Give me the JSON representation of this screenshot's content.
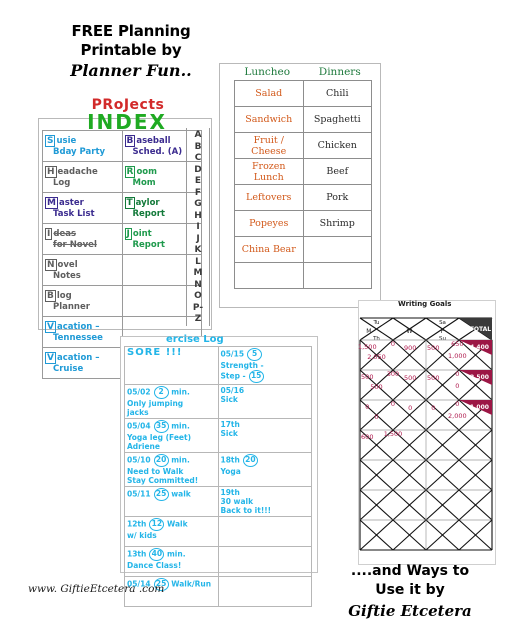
{
  "header": {
    "line1": "FREE Planning",
    "line2": "Printable by",
    "brand": "Planner Fun.."
  },
  "projects": {
    "kicker": "PRoJects",
    "title": "INDEX",
    "rows": [
      {
        "left": {
          "initial": "S",
          "l1": "usie",
          "l2": "Bday Party",
          "color": "c-blue",
          "strike": false,
          "suffix": ""
        },
        "right": {
          "initial": "B",
          "l1": "aseball",
          "l2": "Sched.",
          "color": "c-purple",
          "strike": false,
          "suffix": "A"
        }
      },
      {
        "left": {
          "initial": "H",
          "l1": "eadache",
          "l2": "Log",
          "color": "c-gray",
          "strike": false,
          "suffix": ""
        },
        "right": {
          "initial": "R",
          "l1": "oom",
          "l2": "Mom",
          "color": "c-green",
          "strike": false,
          "suffix": ""
        }
      },
      {
        "left": {
          "initial": "M",
          "l1": "aster",
          "l2": "Task List",
          "color": "c-purple",
          "strike": false,
          "suffix": ""
        },
        "right": {
          "initial": "T",
          "l1": "aylor",
          "l2": "Report",
          "color": "c-dgreen",
          "strike": false,
          "suffix": ""
        }
      },
      {
        "left": {
          "initial": "I",
          "l1": "deas",
          "l2": "for Novel",
          "color": "c-gray",
          "strike": true,
          "suffix": ""
        },
        "right": {
          "initial": "J",
          "l1": "oint",
          "l2": "Report",
          "color": "c-green",
          "strike": false,
          "suffix": ""
        }
      },
      {
        "left": {
          "initial": "N",
          "l1": "ovel",
          "l2": "Notes",
          "color": "c-gray",
          "strike": false,
          "suffix": ""
        },
        "right": {
          "initial": "",
          "l1": "",
          "l2": "",
          "color": "c-gray",
          "strike": false,
          "suffix": ""
        }
      },
      {
        "left": {
          "initial": "B",
          "l1": "log",
          "l2": "Planner",
          "color": "c-gray",
          "strike": false,
          "suffix": ""
        },
        "right": {
          "initial": "",
          "l1": "",
          "l2": "",
          "color": "c-gray",
          "strike": false,
          "suffix": ""
        }
      },
      {
        "left": {
          "initial": "V",
          "l1": "acation –",
          "l2": "Tennessee",
          "color": "c-blue",
          "strike": false,
          "suffix": ""
        },
        "right": {
          "initial": "",
          "l1": "",
          "l2": "",
          "color": "c-gray",
          "strike": false,
          "suffix": ""
        }
      },
      {
        "left": {
          "initial": "V",
          "l1": "acation –",
          "l2": "Cruise",
          "color": "c-blue",
          "strike": false,
          "suffix": ""
        },
        "right": {
          "initial": "",
          "l1": "",
          "l2": "",
          "color": "c-gray",
          "strike": false,
          "suffix": ""
        }
      }
    ],
    "alphabet_tabs": [
      "A",
      "B",
      "C",
      "D",
      "E",
      "F",
      "G",
      "H",
      "I",
      "J",
      "K",
      "L",
      "M",
      "N",
      "O",
      "P-",
      "Z"
    ]
  },
  "meals": {
    "headers": [
      "Luncheo",
      "Dinners"
    ],
    "rows": [
      {
        "lunch": "Salad",
        "dinner": "Chili",
        "small": false
      },
      {
        "lunch": "Sandwich",
        "dinner": "Spaghetti",
        "small": false
      },
      {
        "lunch": "Fruit / Cheese",
        "dinner": "Chicken",
        "small": true
      },
      {
        "lunch": "Frozen Lunch",
        "dinner": "Beef",
        "small": true
      },
      {
        "lunch": "Leftovers",
        "dinner": "Pork",
        "small": false
      },
      {
        "lunch": "Popeyes",
        "dinner": "Shrimp",
        "small": false
      },
      {
        "lunch": "China Bear",
        "dinner": "",
        "small": false
      },
      {
        "lunch": "",
        "dinner": "",
        "small": false
      }
    ]
  },
  "exercise": {
    "title": "ercise Log",
    "banner": "SORE !!!",
    "rows": [
      {
        "left": {
          "date": "",
          "badge": "",
          "note1": "SORE !!!",
          "note2": "",
          "note3": "",
          "banner": true
        },
        "right": {
          "date": "05/15",
          "badge": "5",
          "note1": "Strength -",
          "note2": "Step -",
          "badge2": "15",
          "note3": ""
        }
      },
      {
        "left": {
          "date": "05/02",
          "badge": "2",
          "unit": "min.",
          "note1": "Only jumping",
          "note2": "jacks",
          "note3": ""
        },
        "right": {
          "date": "05/16",
          "badge": "",
          "note1": "Sick",
          "note2": "",
          "note3": ""
        }
      },
      {
        "left": {
          "date": "05/04",
          "badge": "35",
          "unit": "min.",
          "note1": "Yoga leg (Feet)",
          "note2": "Adriene",
          "note3": ""
        },
        "right": {
          "date": "17th",
          "badge": "",
          "note1": "Sick",
          "note2": "",
          "note3": ""
        }
      },
      {
        "left": {
          "date": "05/10",
          "badge": "20",
          "unit": "min.",
          "note1": "Need to Walk",
          "note2": "Stay Committed!",
          "note3": ""
        },
        "right": {
          "date": "18th",
          "badge": "20",
          "note1": "Yoga",
          "note2": "",
          "note3": ""
        }
      },
      {
        "left": {
          "date": "05/11",
          "badge": "25",
          "unit": "walk",
          "note1": "",
          "note2": "",
          "note3": ""
        },
        "right": {
          "date": "19th",
          "badge": "",
          "note1": "30 walk",
          "note2": "Back to it!!!",
          "note3": ""
        }
      },
      {
        "left": {
          "date": "12th",
          "badge": "12",
          "unit": "Walk",
          "note1": "w/ kids",
          "note2": "",
          "note3": ""
        },
        "right": {
          "date": "",
          "badge": "",
          "note1": "",
          "note2": "",
          "note3": ""
        }
      },
      {
        "left": {
          "date": "13th",
          "badge": "40",
          "unit": "min.",
          "note1": "Dance Class!",
          "note2": "",
          "note3": ""
        },
        "right": {
          "date": "",
          "badge": "",
          "note1": "",
          "note2": "",
          "note3": ""
        }
      },
      {
        "left": {
          "date": "05/14",
          "badge": "25",
          "unit": "Walk/Run",
          "note1": "",
          "note2": "",
          "note3": ""
        },
        "right": {
          "date": "",
          "badge": "",
          "note1": "",
          "note2": "",
          "note3": ""
        }
      }
    ]
  },
  "chart_data": {
    "type": "table",
    "title": "Writing Goals",
    "columns": [
      "Sun",
      "M",
      "Tu",
      "W",
      "Th",
      "F",
      "Sa",
      "Su",
      "TOTAL"
    ],
    "top_labels": [
      "Tu",
      "Sa",
      "TOTAL"
    ],
    "mid_labels": [
      "M",
      "W",
      "F"
    ],
    "bottom_labels": [
      "Th",
      "Su"
    ],
    "accent_color": "#9c1645",
    "ink_color": "#b01a4e",
    "total_header_bg": "#3a3a3a",
    "rows": [
      {
        "values": [
          "1,500",
          "2,050",
          "0",
          "900",
          "500",
          "650",
          "1,000"
        ],
        "total": "4,400"
      },
      {
        "values": [
          "500",
          "500",
          "300",
          "500",
          "500",
          "0",
          "0"
        ],
        "total": "2,500"
      },
      {
        "values": [
          "0",
          "0",
          "0",
          "0",
          "0",
          "0",
          "2,000"
        ],
        "total": "1,000"
      },
      {
        "values": [
          "600",
          "",
          "1,500",
          "",
          "",
          "",
          ""
        ],
        "total": ""
      },
      {
        "values": [
          "",
          "",
          "",
          "",
          "",
          "",
          ""
        ],
        "total": ""
      },
      {
        "values": [
          "",
          "",
          "",
          "",
          "",
          "",
          ""
        ],
        "total": ""
      },
      {
        "values": [
          "",
          "",
          "",
          "",
          "",
          "",
          ""
        ],
        "total": ""
      }
    ],
    "xlabel": "",
    "ylabel": "",
    "grid": true,
    "legend": "none"
  },
  "footer": {
    "url": "www. GiftieEtcetera .com",
    "closing_line1": "....and Ways to",
    "closing_line2": "Use it by",
    "closing_brand": "Giftie Etcetera"
  }
}
